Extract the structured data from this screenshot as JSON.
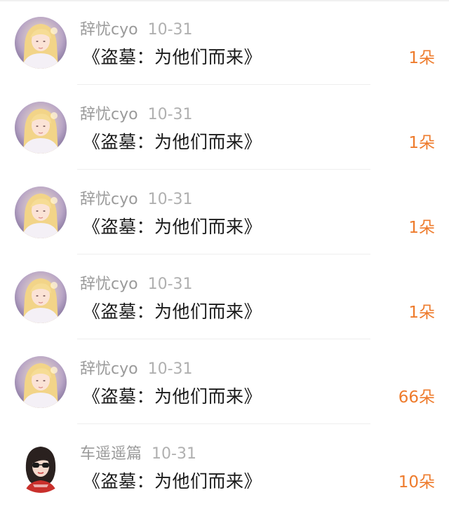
{
  "accent_color": "#ee7b2c",
  "items": [
    {
      "user": "辞忧cyo",
      "date": "10-31",
      "title": "《盗墓：为他们而来》",
      "count": "1朵",
      "avatar": "blonde-girl-avatar"
    },
    {
      "user": "辞忧cyo",
      "date": "10-31",
      "title": "《盗墓：为他们而来》",
      "count": "1朵",
      "avatar": "blonde-girl-avatar"
    },
    {
      "user": "辞忧cyo",
      "date": "10-31",
      "title": "《盗墓：为他们而来》",
      "count": "1朵",
      "avatar": "blonde-girl-avatar"
    },
    {
      "user": "辞忧cyo",
      "date": "10-31",
      "title": "《盗墓：为他们而来》",
      "count": "1朵",
      "avatar": "blonde-girl-avatar"
    },
    {
      "user": "辞忧cyo",
      "date": "10-31",
      "title": "《盗墓：为他们而来》",
      "count": "66朵",
      "avatar": "blonde-girl-avatar"
    },
    {
      "user": "车遥遥篇",
      "date": "10-31",
      "title": "《盗墓：为他们而来》",
      "count": "10朵",
      "avatar": "sunglasses-girl-avatar"
    }
  ]
}
